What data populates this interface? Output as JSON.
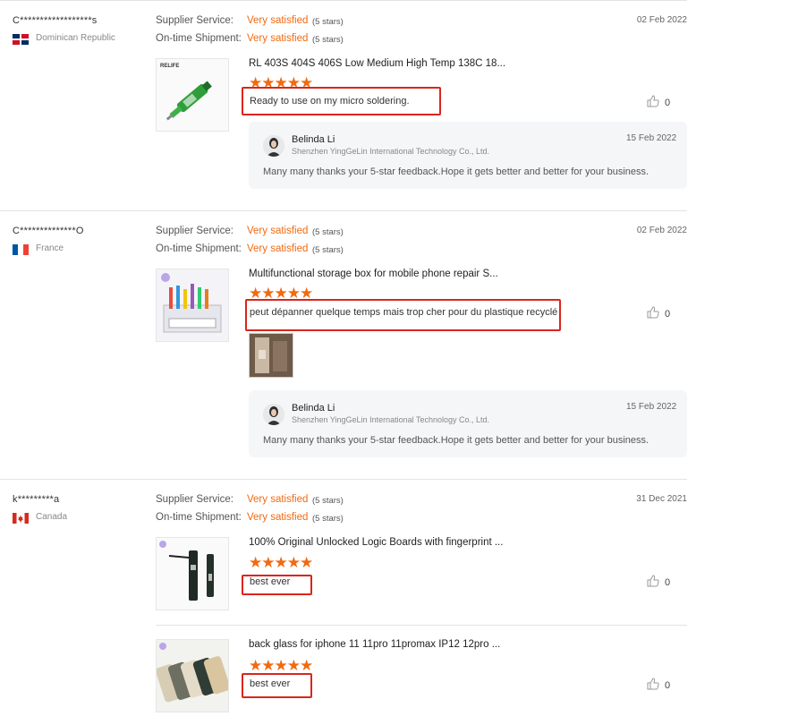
{
  "reviews": [
    {
      "buyer": "C******************s",
      "country": "Dominican Republic",
      "supplier_label": "Supplier Service:",
      "supplier_value": "Very satisfied",
      "supplier_stars": "(5 stars)",
      "shipment_label": "On-time Shipment:",
      "shipment_value": "Very satisfied",
      "shipment_stars": "(5 stars)",
      "date": "02 Feb 2022",
      "product_title": "RL 403S 404S 406S Low Medium High Temp 138C 18...",
      "rating": "★★★★★",
      "review_text": "Ready to use on my micro soldering.",
      "likes": "0",
      "reply": {
        "name": "Belinda Li",
        "company": "Shenzhen YingGeLin International Technology Co., Ltd.",
        "date": "15 Feb 2022",
        "text": "Many many thanks your 5-star feedback.Hope it gets better and better for your business."
      }
    },
    {
      "buyer": "C**************O",
      "country": "France",
      "supplier_label": "Supplier Service:",
      "supplier_value": "Very satisfied",
      "supplier_stars": "(5 stars)",
      "shipment_label": "On-time Shipment:",
      "shipment_value": "Very satisfied",
      "shipment_stars": "(5 stars)",
      "date": "02 Feb 2022",
      "product_title": "Multifunctional storage box for mobile phone repair S...",
      "rating": "★★★★★",
      "review_text": "peut dépanner quelque temps mais trop cher pour du plastique recyclé",
      "likes": "0",
      "reply": {
        "name": "Belinda Li",
        "company": "Shenzhen YingGeLin International Technology Co., Ltd.",
        "date": "15 Feb 2022",
        "text": "Many many thanks your 5-star feedback.Hope it gets better and better for your business."
      }
    },
    {
      "buyer": "k*********a",
      "country": "Canada",
      "supplier_label": "Supplier Service:",
      "supplier_value": "Very satisfied",
      "supplier_stars": "(5 stars)",
      "shipment_label": "On-time Shipment:",
      "shipment_value": "Very satisfied",
      "shipment_stars": "(5 stars)",
      "date": "31 Dec 2021",
      "products": [
        {
          "title": "100% Original Unlocked Logic Boards with fingerprint ...",
          "rating": "★★★★★",
          "review_text": "best ever",
          "likes": "0"
        },
        {
          "title": "back glass for iphone 11 11pro 11promax IP12 12pro ...",
          "rating": "★★★★★",
          "review_text": "best ever",
          "likes": "0"
        }
      ]
    }
  ],
  "colors": {
    "accent": "#f26a10",
    "highlight_box": "#d9261c"
  },
  "icons": {
    "like": "thumbs-up-icon"
  }
}
